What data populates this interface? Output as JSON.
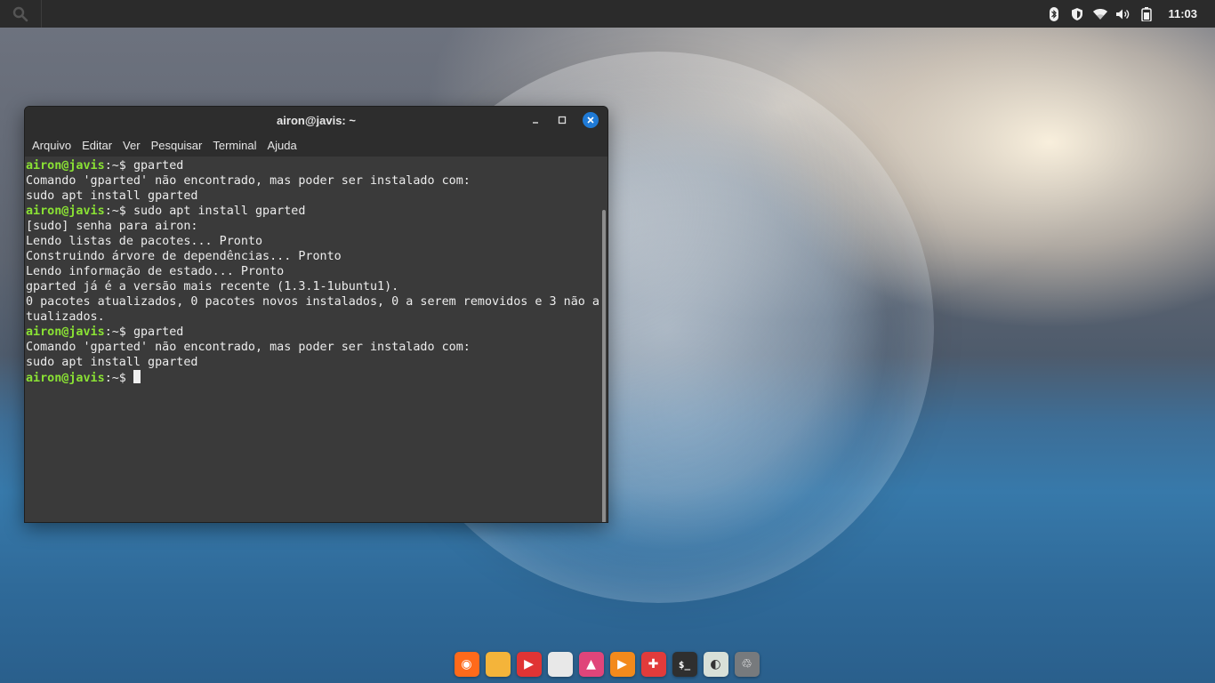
{
  "topbar": {
    "clock": "11:03",
    "tray_icons": [
      "bluetooth-icon",
      "shield-icon",
      "wifi-icon",
      "volume-icon",
      "battery-icon"
    ]
  },
  "window": {
    "title": "airon@javis: ~",
    "menu": [
      "Arquivo",
      "Editar",
      "Ver",
      "Pesquisar",
      "Terminal",
      "Ajuda"
    ]
  },
  "terminal": {
    "user_host": "airon@javis",
    "path": "~",
    "lines": [
      {
        "type": "prompt",
        "cmd": "gparted"
      },
      {
        "type": "out",
        "text": "Comando 'gparted' não encontrado, mas poder ser instalado com:"
      },
      {
        "type": "out",
        "text": "sudo apt install gparted"
      },
      {
        "type": "prompt",
        "cmd": "sudo apt install gparted"
      },
      {
        "type": "out",
        "text": "[sudo] senha para airon:"
      },
      {
        "type": "out",
        "text": "Lendo listas de pacotes... Pronto"
      },
      {
        "type": "out",
        "text": "Construindo árvore de dependências... Pronto"
      },
      {
        "type": "out",
        "text": "Lendo informação de estado... Pronto"
      },
      {
        "type": "out",
        "text": "gparted já é a versão mais recente (1.3.1-1ubuntu1)."
      },
      {
        "type": "out",
        "text": "0 pacotes atualizados, 0 pacotes novos instalados, 0 a serem removidos e 3 não a"
      },
      {
        "type": "out",
        "text": "tualizados."
      },
      {
        "type": "prompt",
        "cmd": "gparted"
      },
      {
        "type": "out",
        "text": "Comando 'gparted' não encontrado, mas poder ser instalado com:"
      },
      {
        "type": "out",
        "text": "sudo apt install gparted"
      },
      {
        "type": "prompt",
        "cmd": "",
        "cursor": true
      }
    ]
  },
  "dock": {
    "items": [
      {
        "name": "firefox-icon",
        "glyph": "◉",
        "color": "#ff6a1a"
      },
      {
        "name": "files-icon",
        "glyph": "",
        "color": "#f4b43a"
      },
      {
        "name": "video-player-icon",
        "glyph": "▶",
        "color": "#e03434"
      },
      {
        "name": "text-editor-icon",
        "glyph": "",
        "color": "#e8e8e8"
      },
      {
        "name": "image-viewer-icon",
        "glyph": "▲",
        "color": "#e0457a"
      },
      {
        "name": "media-player-icon",
        "glyph": "▶",
        "color": "#f38a1c"
      },
      {
        "name": "software-center-icon",
        "glyph": "✚",
        "color": "#e23b3b"
      },
      {
        "name": "terminal-icon",
        "glyph": "$_",
        "color": "#2f2f2f"
      },
      {
        "name": "settings-icon",
        "glyph": "◐",
        "color": "#d8e0d8"
      },
      {
        "name": "trash-icon",
        "glyph": "♲",
        "color": "#777a7d"
      }
    ]
  }
}
